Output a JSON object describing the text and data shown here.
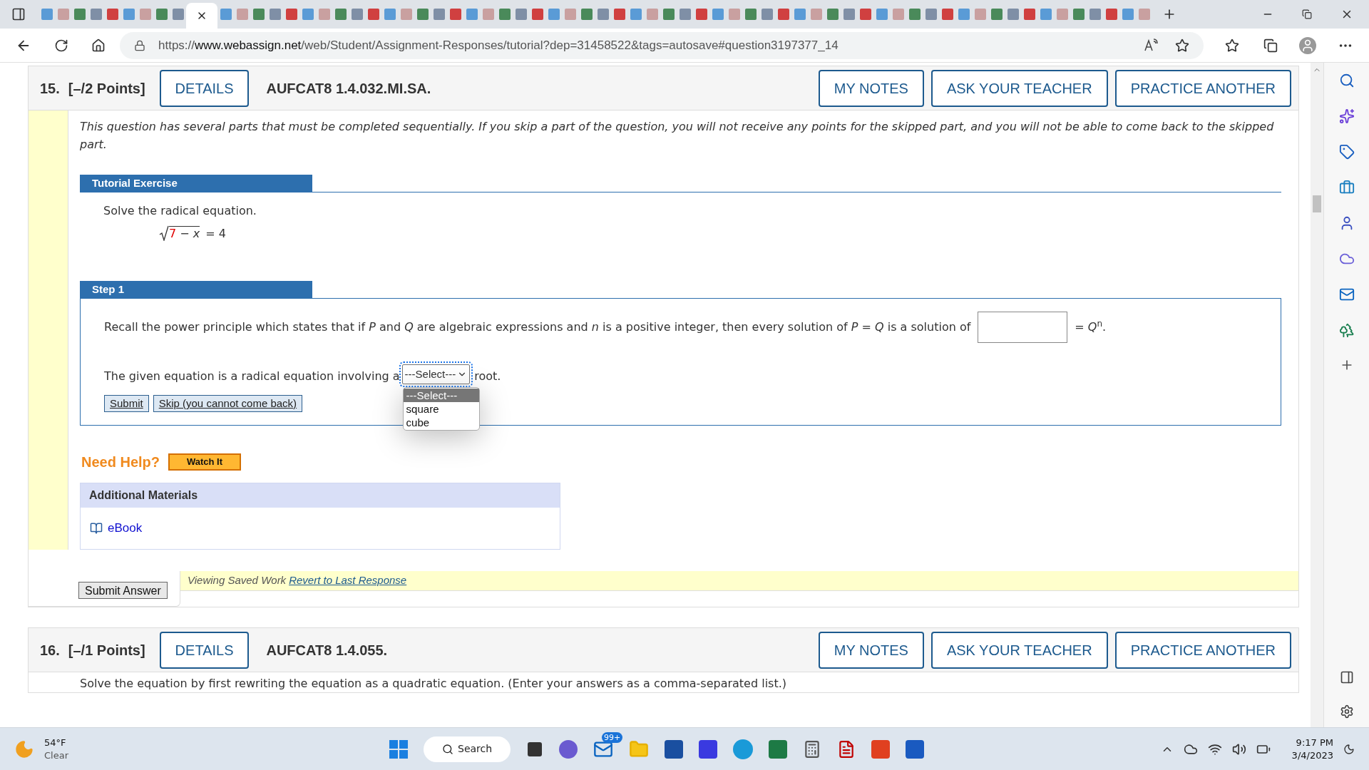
{
  "browser": {
    "tabs": [
      {
        "selected": false
      },
      {
        "selected": false
      },
      {
        "selected": false
      },
      {
        "selected": false
      },
      {
        "selected": false
      },
      {
        "selected": false
      },
      {
        "selected": false
      },
      {
        "selected": false
      },
      {
        "selected": false
      },
      {
        "selected": true
      },
      {
        "selected": false
      },
      {
        "selected": false
      },
      {
        "selected": false
      },
      {
        "selected": false
      },
      {
        "selected": false
      },
      {
        "selected": false
      },
      {
        "selected": false
      },
      {
        "selected": false
      },
      {
        "selected": false
      },
      {
        "selected": false
      },
      {
        "selected": false
      },
      {
        "selected": false
      },
      {
        "selected": false
      },
      {
        "selected": false
      },
      {
        "selected": false
      },
      {
        "selected": false
      },
      {
        "selected": false
      },
      {
        "selected": false
      },
      {
        "selected": false
      },
      {
        "selected": false
      },
      {
        "selected": false
      },
      {
        "selected": false
      },
      {
        "selected": false
      },
      {
        "selected": false
      },
      {
        "selected": false
      },
      {
        "selected": false
      },
      {
        "selected": false
      },
      {
        "selected": false
      },
      {
        "selected": false
      },
      {
        "selected": false
      },
      {
        "selected": false
      },
      {
        "selected": false
      },
      {
        "selected": false
      },
      {
        "selected": false
      },
      {
        "selected": false
      },
      {
        "selected": false
      },
      {
        "selected": false
      },
      {
        "selected": false
      },
      {
        "selected": false
      },
      {
        "selected": false
      },
      {
        "selected": false
      },
      {
        "selected": false
      },
      {
        "selected": false
      },
      {
        "selected": false
      },
      {
        "selected": false
      },
      {
        "selected": false
      },
      {
        "selected": false
      },
      {
        "selected": false
      },
      {
        "selected": false
      },
      {
        "selected": false
      },
      {
        "selected": false
      },
      {
        "selected": false
      },
      {
        "selected": false
      },
      {
        "selected": false
      },
      {
        "selected": false
      },
      {
        "selected": false
      },
      {
        "selected": false
      }
    ],
    "address": {
      "scheme": "https://",
      "host": "www.webassign.net",
      "path": "/web/Student/Assignment-Responses/tutorial?dep=31458522&tags=autosave#question3197377_14"
    }
  },
  "question_15": {
    "number": "15.",
    "points": "[–/2 Points]",
    "details_button": "DETAILS",
    "code": "AUFCAT8 1.4.032.MI.SA.",
    "actions": [
      "MY NOTES",
      "ASK YOUR TEACHER",
      "PRACTICE ANOTHER"
    ],
    "instructions": "This question has several parts that must be completed sequentially. If you skip a part of the question, you will not receive any points for the skipped part, and you will not be able to come back to the skipped part.",
    "tutorial": {
      "heading": "Tutorial Exercise",
      "prompt": "Solve the radical equation.",
      "equation": {
        "highlight": "7",
        "radicand_rest": " − *x*",
        "rhs": "= 4"
      }
    },
    "step": {
      "heading": "Step 1",
      "sentence_1": "Recall the power principle which states that if *P* and *Q* are algebraic expressions and *n* is a positive integer, then every solution of  *P* = *Q*  is a solution of",
      "sentence_1_end": "= *Q*$^{n}$.",
      "sentence_2": "The given equation is a radical equation involving a",
      "sentence_2_end": "root.",
      "select": {
        "value": "---Select---",
        "expanded": true,
        "options": [
          {
            "label": "---Select---",
            "selected": true
          },
          {
            "label": "square",
            "selected": false
          },
          {
            "label": "cube",
            "selected": false
          }
        ]
      },
      "buttons": [
        "Submit",
        "Skip (you cannot come back)"
      ]
    },
    "help": {
      "title": "Need Help?",
      "watch_button": "Watch It"
    },
    "materials": {
      "heading": "Additional Materials",
      "link": "eBook"
    },
    "submit_button": "Submit Answer",
    "saved": {
      "text": "Viewing Saved Work",
      "link": "Revert to Last Response"
    }
  },
  "question_16": {
    "number": "16.",
    "points": "[–/1 Points]",
    "details_button": "DETAILS",
    "code": "AUFCAT8 1.4.055.",
    "actions": [
      "MY NOTES",
      "ASK YOUR TEACHER",
      "PRACTICE ANOTHER"
    ],
    "text": "Solve the equation by first rewriting the equation as a quadratic equation. (Enter your answers as a comma-separated list.)"
  },
  "taskbar": {
    "weather": {
      "temp": "54°F",
      "condition": "Clear"
    },
    "search": "Search",
    "mail_badge": "99+",
    "time": "9:17 PM",
    "date": "3/4/2023"
  }
}
